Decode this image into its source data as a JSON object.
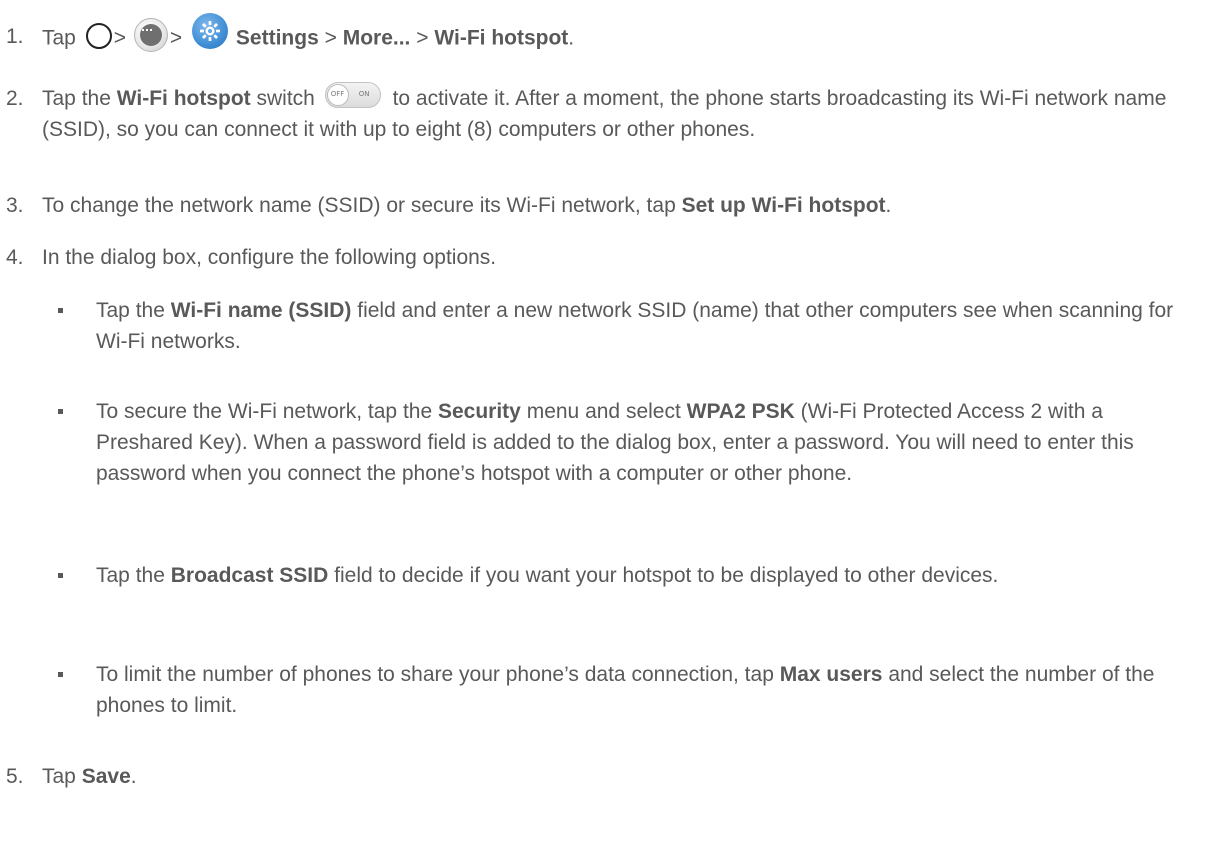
{
  "steps": [
    {
      "num": "1.",
      "t1": "Tap",
      "t2": ">",
      "t3": ">",
      "settings": "Settings",
      "t4": ">",
      "more": "More...",
      "t5": ">",
      "hotspot": "Wi-Fi hotspot",
      "t6": "."
    },
    {
      "num": "2.",
      "t1": "Tap the",
      "hotspot": "Wi-Fi hotspot",
      "t2": "switch",
      "t3": "to activate it. After a moment, the phone starts broadcasting its Wi-Fi network name (SSID), so you can connect it with up to eight (8) computers or other phones."
    },
    {
      "num": "3.",
      "t1": "To change the network name (SSID) or secure its Wi-Fi network, tap",
      "setup": "Set up Wi-Fi hotspot",
      "t2": "."
    },
    {
      "num": "4.",
      "t1": "In the dialog box, configure the following options."
    },
    {
      "num": "5.",
      "t1": "Tap",
      "save": "Save",
      "t2": "."
    }
  ],
  "bullets": [
    {
      "t1": "Tap the",
      "b1": "Wi-Fi name (SSID)",
      "t2": "field and enter a new network SSID (name) that other computers see when scanning for Wi-Fi networks."
    },
    {
      "t1": "To secure the Wi-Fi network, tap the",
      "b1": "Security",
      "t2": "menu and select",
      "b2": "WPA2 PSK",
      "t3": "(Wi-Fi Protected Access 2 with a Preshared Key). When a password field is added to the dialog box, enter a password. You will need to enter this password when you connect the phone’s hotspot with a computer or other phone."
    },
    {
      "t1": "Tap the",
      "b1": "Broadcast SSID",
      "t2": "field to decide if you want your hotspot to be displayed to other devices."
    },
    {
      "t1": "To limit the number of phones to share your phone’s data connection, tap",
      "b1": "Max users",
      "t2": "and select the number of the phones to limit."
    }
  ],
  "toggle": {
    "off": "OFF",
    "on": "ON"
  },
  "icons": [
    "home-icon",
    "apps-icon",
    "settings-gear-icon",
    "toggle-switch-icon"
  ]
}
